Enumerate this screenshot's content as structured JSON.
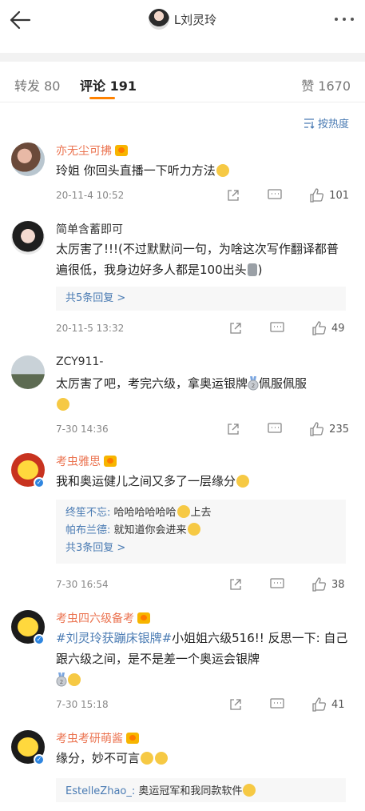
{
  "header": {
    "title": "L刘灵玲"
  },
  "tabs": {
    "repost": "转发 80",
    "comment": "评论 191",
    "like": "赞 1670"
  },
  "sort": {
    "label": "按热度"
  },
  "comments": [
    {
      "name": "亦无尘可拂",
      "text": "玲姐 你回头直播一下听力方法",
      "time": "20-11-4 10:52",
      "likes": "101"
    },
    {
      "name": "简单含蓄即可",
      "text": "太厉害了!!!(不过默默问一句，为啥这次写作翻译都普遍很低，我身边好多人都是100出头",
      "text_end": ")",
      "more": "共5条回复 >",
      "time": "20-11-5 13:32",
      "likes": "49"
    },
    {
      "name": "ZCY911-",
      "text": "太厉害了吧，考完六级，拿奥运银牌",
      "text_mid": "佩服佩服",
      "time": "7-30 14:36",
      "likes": "235"
    },
    {
      "name": "考虫雅思",
      "text": "我和奥运健儿之间又多了一层缘分",
      "replies": [
        {
          "name": "终笙不忘:",
          "text": "哈哈哈哈哈哈",
          "text_end": "上去"
        },
        {
          "name": "帕布兰德:",
          "text": "就知道你会进来"
        }
      ],
      "more": "共3条回复 >",
      "time": "7-30 16:54",
      "likes": "38"
    },
    {
      "name": "考虫四六级备考",
      "topic": "#刘灵玲获蹦床银牌#",
      "text": "小姐姐六级516!! 反思一下: 自己跟六级之间，是不是差一个奥运会银牌",
      "time": "7-30 15:18",
      "likes": "41"
    },
    {
      "name": "考虫考研萌酱",
      "text": "缘分，妙不可言",
      "replies": [
        {
          "name": "EstelleZhao_:",
          "text": "奥运冠军和我同款软件"
        }
      ]
    }
  ],
  "colors": {
    "accent": "#ff8200",
    "link": "#4a7bb3",
    "vip_name": "#eb7350"
  }
}
